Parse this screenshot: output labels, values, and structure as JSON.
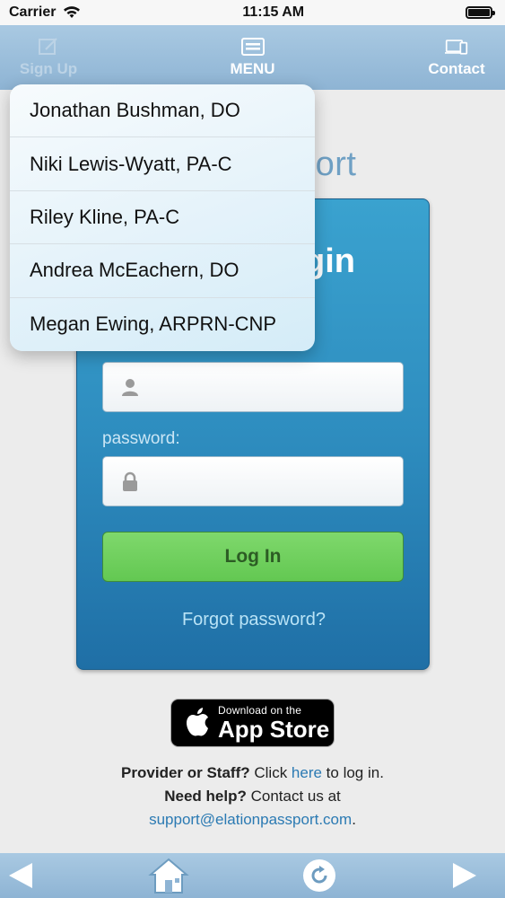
{
  "status_bar": {
    "carrier": "Carrier",
    "time": "11:15 AM"
  },
  "top_nav": {
    "signup_label": "Sign Up",
    "menu_label": "MENU",
    "contact_label": "Contact"
  },
  "brand": {
    "partial_text": "port"
  },
  "login": {
    "title_partial": "gin",
    "username_placeholder": "",
    "password_label": "password:",
    "password_placeholder": "",
    "login_button": "Log In",
    "forgot_link": "Forgot password?"
  },
  "appstore": {
    "small": "Download on the",
    "big": "App Store"
  },
  "footer": {
    "provider_bold": "Provider or Staff?",
    "click": " Click ",
    "here": "here",
    "to_login": " to log in.",
    "help_bold": "Need help?",
    "contact": " Contact us at",
    "email": "support@elationpassport.com",
    "period": "."
  },
  "dropdown": {
    "items": [
      {
        "label": "Jonathan Bushman, DO"
      },
      {
        "label": "Niki Lewis-Wyatt, PA-C"
      },
      {
        "label": "Riley Kline, PA-C"
      },
      {
        "label": "Andrea McEachern, DO"
      },
      {
        "label": "Megan Ewing, ARPRN-CNP"
      }
    ]
  },
  "icons": {
    "back": "back-arrow-icon",
    "home": "home-icon",
    "refresh": "refresh-icon",
    "forward": "forward-arrow-icon"
  },
  "colors": {
    "nav_blue": "#8eb4d4",
    "card_blue": "#2e8dbf",
    "login_green": "#63c852",
    "link_blue": "#2b7ab3"
  }
}
